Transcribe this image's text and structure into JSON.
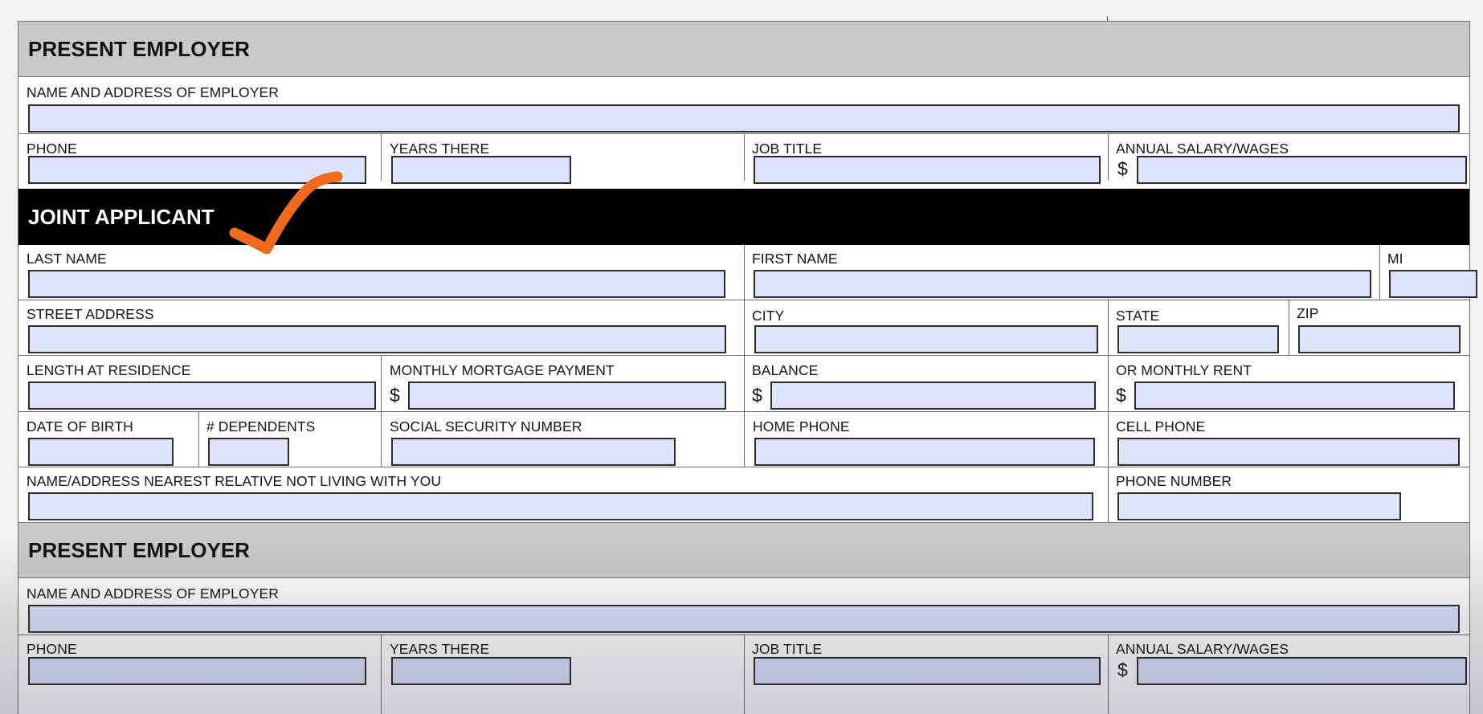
{
  "employer_section": {
    "header": "PRESENT EMPLOYER",
    "name_address_label": "NAME AND ADDRESS OF EMPLOYER",
    "phone_label": "PHONE",
    "years_label": "YEARS THERE",
    "job_title_label": "JOB TITLE",
    "salary_label": "ANNUAL SALARY/WAGES",
    "currency": "$"
  },
  "joint_applicant": {
    "header": "JOINT APPLICANT",
    "last_name_label": "LAST NAME",
    "first_name_label": "FIRST NAME",
    "mi_label": "MI",
    "street_label": "STREET ADDRESS",
    "city_label": "CITY",
    "state_label": "STATE",
    "zip_label": "ZIP",
    "length_residence_label": "LENGTH AT RESIDENCE",
    "mortgage_label": "MONTHLY MORTGAGE PAYMENT",
    "balance_label": "BALANCE",
    "rent_label": "OR MONTHLY RENT",
    "dob_label": "DATE OF BIRTH",
    "dependents_label": "# DEPENDENTS",
    "ssn_label": "SOCIAL SECURITY NUMBER",
    "home_phone_label": "HOME PHONE",
    "cell_phone_label": "CELL PHONE",
    "relative_label": "NAME/ADDRESS  NEAREST RELATIVE NOT LIVING WITH YOU",
    "relative_phone_label": "PHONE NUMBER",
    "currency": "$"
  },
  "annotation": {
    "checkmark_icon": "checkmark-icon",
    "checkmark_color": "#ee6a1f"
  },
  "colors": {
    "field_fill": "#dde3fb",
    "gray_band": "#c9c9cb",
    "black_band": "#000000"
  }
}
